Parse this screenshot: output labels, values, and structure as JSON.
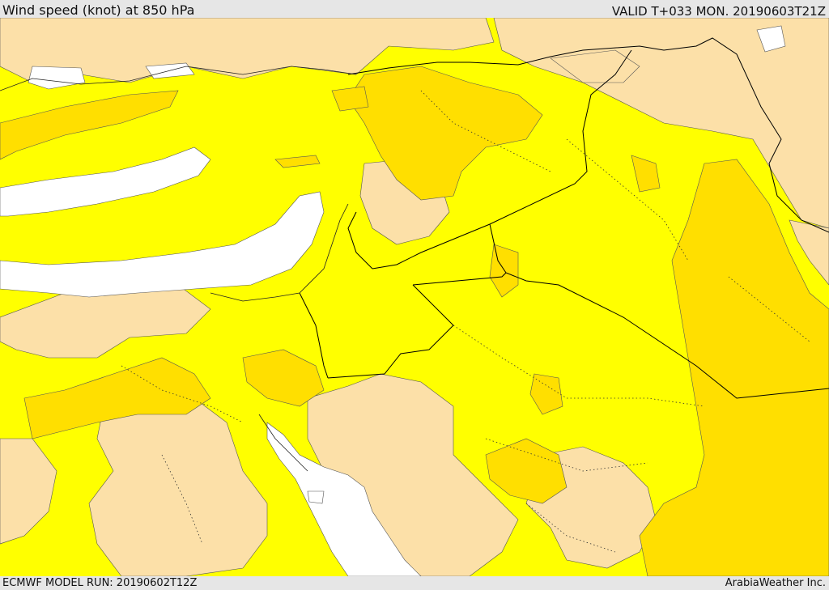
{
  "header": {
    "title": "Wind speed (knot) at 850 hPa",
    "valid": "VALID T+033 MON. 20190603T21Z"
  },
  "footer": {
    "model_run": "ECMWF MODEL RUN: 20190602T12Z",
    "credit": "ArabiaWeather Inc."
  },
  "colors": {
    "calm": "#ffffff",
    "light": "#fce0a8",
    "moderate": "#ffff00",
    "fresh": "#ffdf00",
    "strong": "#ffd000",
    "coastline": "#333333",
    "border": "#000000"
  }
}
